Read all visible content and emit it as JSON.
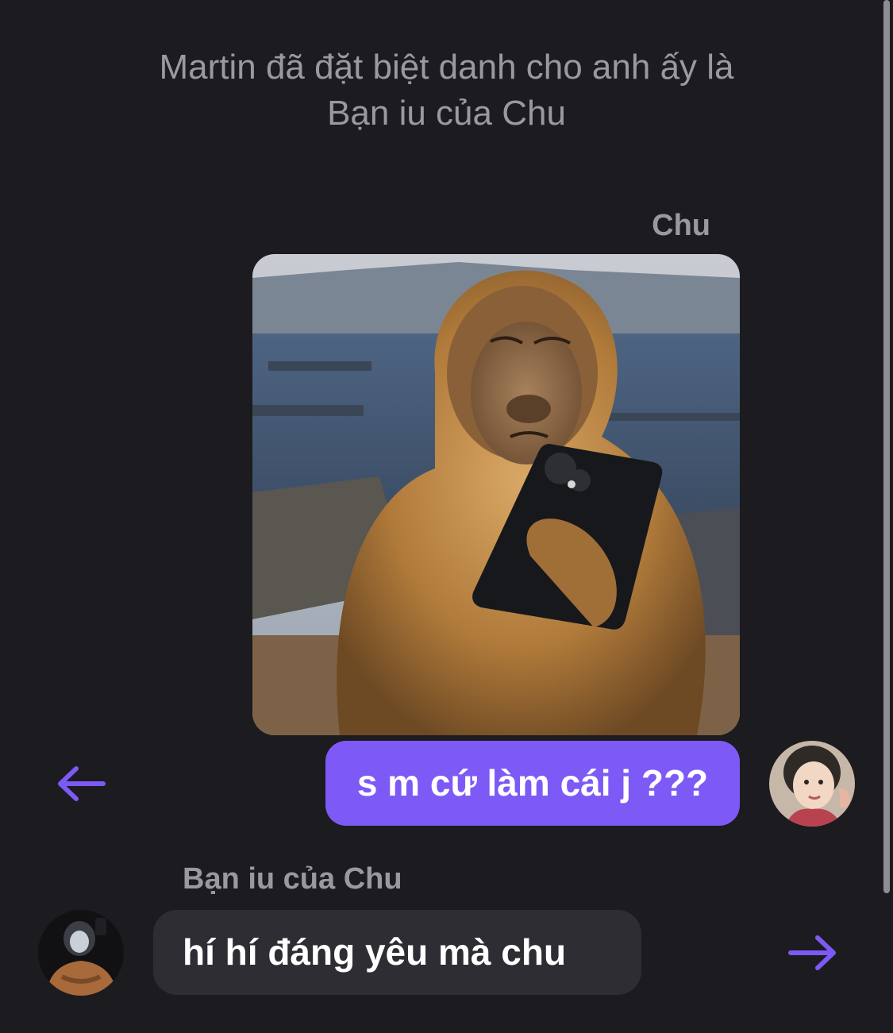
{
  "system_notice": {
    "line1": "Martin đã đặt biệt danh cho anh ấy là",
    "line2": "Bạn iu của Chu"
  },
  "messages": {
    "outgoing": {
      "sender": "Chu",
      "image_icon": "monkey-holding-phone-meme",
      "text": "s m cứ làm cái j ???"
    },
    "incoming": {
      "sender": "Bạn iu của Chu",
      "text": "hí hí đáng yêu mà chu"
    }
  },
  "colors": {
    "background": "#1c1b20",
    "outgoing_bubble": "#7d5af5",
    "incoming_bubble": "#2e2d33",
    "muted_text": "#9a99a1",
    "accent_arrow": "#7d5af5"
  },
  "icons": {
    "reply_left": "arrow-left-icon",
    "reply_right": "arrow-right-icon"
  }
}
